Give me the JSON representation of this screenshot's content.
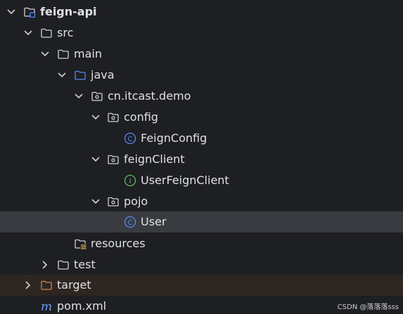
{
  "project_tree": {
    "root": {
      "label": "feign-api",
      "expanded": true
    },
    "src": {
      "label": "src",
      "expanded": true
    },
    "main": {
      "label": "main",
      "expanded": true
    },
    "java": {
      "label": "java",
      "expanded": true
    },
    "package": {
      "label": "cn.itcast.demo",
      "expanded": true
    },
    "config": {
      "label": "config",
      "expanded": true
    },
    "feign_config": {
      "label": "FeignConfig",
      "kind": "class"
    },
    "feign_client_pkg": {
      "label": "feignClient",
      "expanded": true
    },
    "user_feign_client": {
      "label": "UserFeignClient",
      "kind": "interface"
    },
    "pojo": {
      "label": "pojo",
      "expanded": true
    },
    "user": {
      "label": "User",
      "kind": "class",
      "selected": true
    },
    "resources": {
      "label": "resources"
    },
    "test": {
      "label": "test",
      "expanded": false
    },
    "target": {
      "label": "target",
      "expanded": false,
      "excluded": true
    },
    "pom": {
      "label": "pom.xml",
      "kind": "maven"
    }
  },
  "icon_glyphs": {
    "class": "C",
    "interface": "I",
    "maven": "m"
  },
  "colors": {
    "background": "#1e1f22",
    "selected_row": "#393b40",
    "excluded_row": "#2e2621",
    "text": "#dfe1e5",
    "folder_outline": "#ced0d6",
    "source_folder": "#548af7",
    "class_icon": "#548af7",
    "interface_icon": "#5fb865",
    "excluded_folder": "#c9824f",
    "resources_lines": "#e0b547",
    "maven_icon": "#6f9bf9"
  },
  "watermark": "CSDN @落落落sss"
}
